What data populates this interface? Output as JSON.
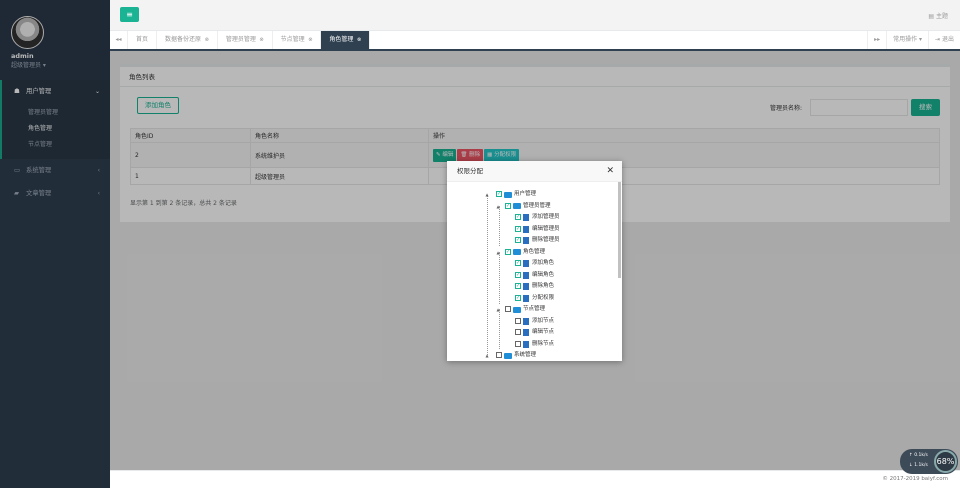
{
  "sidebar": {
    "username": "admin",
    "role": "超级管理员",
    "menu": [
      {
        "label": "用户管理",
        "icon": "users-icon",
        "expanded": true,
        "children": [
          "管理员管理",
          "角色管理",
          "节点管理"
        ]
      },
      {
        "label": "系统管理",
        "icon": "monitor-icon"
      },
      {
        "label": "文章管理",
        "icon": "book-icon"
      }
    ]
  },
  "header": {
    "theme": "主题"
  },
  "tabs": {
    "home": "首页",
    "items": [
      "数据备份还原",
      "管理员管理",
      "节点管理",
      "角色管理"
    ],
    "common_ops": "常用操作",
    "logout": "退出"
  },
  "panel": {
    "title": "角色列表",
    "add_button": "添加角色",
    "search_label": "管理员名称:",
    "search_placeholder": "",
    "search_button": "搜索",
    "columns": [
      "角色ID",
      "角色名称",
      "操作"
    ],
    "rows": [
      {
        "id": "2",
        "name": "系统维护员"
      },
      {
        "id": "1",
        "name": "超级管理员"
      }
    ],
    "ops": {
      "edit": "编辑",
      "delete": "删除",
      "perm": "分配权限"
    },
    "page_info": "显示第 1 到第 2 条记录，总共 2 条记录"
  },
  "modal": {
    "title": "权限分配",
    "tree": {
      "root": "用户管理",
      "admin": "管理员管理",
      "admin_children": [
        "添加管理员",
        "编辑管理员",
        "删除管理员"
      ],
      "role": "角色管理",
      "role_children": [
        "添加角色",
        "编辑角色",
        "删除角色",
        "分配权限"
      ],
      "node": "节点管理",
      "node_children": [
        "添加节点",
        "编辑节点",
        "删除节点"
      ],
      "system": "系统管理"
    }
  },
  "footer": {
    "copyright": "© 2017-2019 baiyf.com"
  },
  "netwidget": {
    "up": "0.1k/s",
    "down": "1.1k/s",
    "percent": "68%"
  },
  "colors": {
    "accent": "#1ab394",
    "sidebar": "#2f4050",
    "danger": "#ed5565",
    "info": "#23c6c8"
  }
}
